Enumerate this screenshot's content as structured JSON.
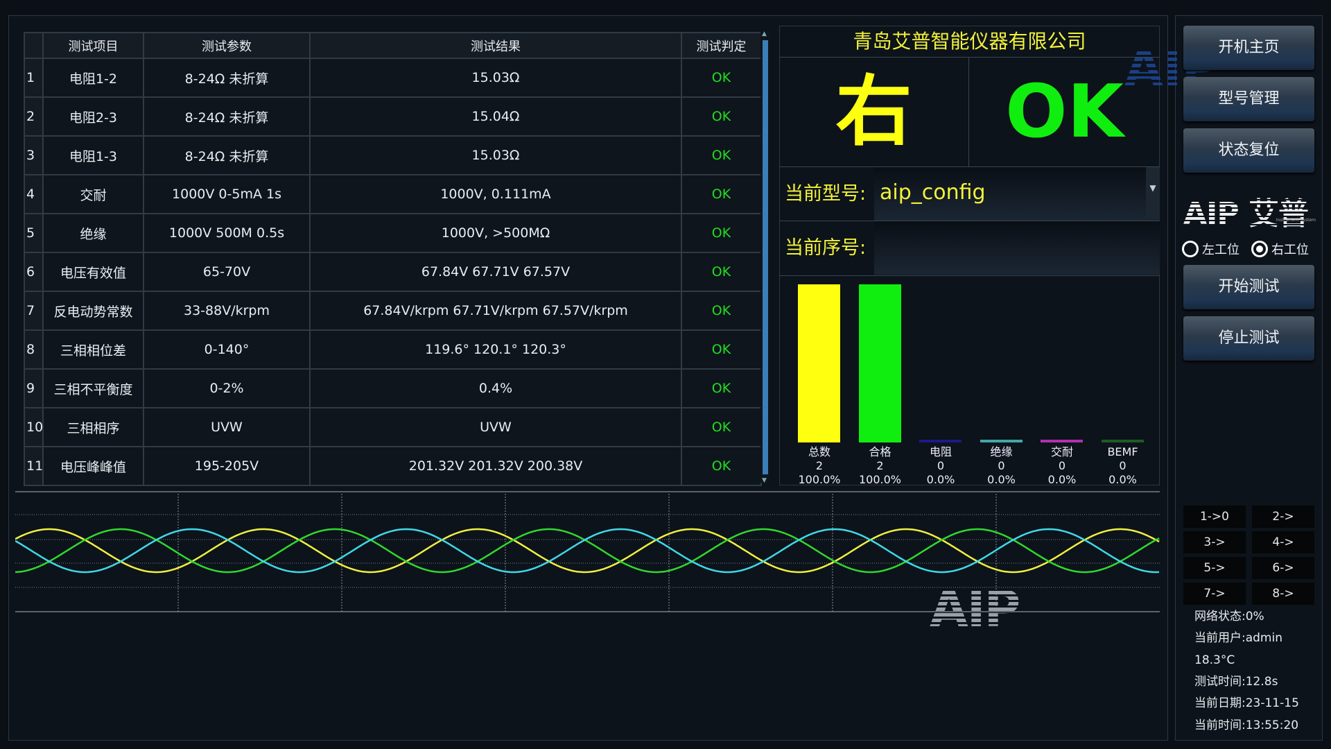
{
  "table": {
    "headers": [
      "",
      "测试项目",
      "测试参数",
      "测试结果",
      "测试判定"
    ],
    "rows": [
      [
        "1",
        "电阻1-2",
        "8-24Ω 未折算",
        "15.03Ω",
        "OK"
      ],
      [
        "2",
        "电阻2-3",
        "8-24Ω 未折算",
        "15.04Ω",
        "OK"
      ],
      [
        "3",
        "电阻1-3",
        "8-24Ω 未折算",
        "15.03Ω",
        "OK"
      ],
      [
        "4",
        "交耐",
        "1000V 0-5mA 1s",
        "1000V, 0.111mA",
        "OK"
      ],
      [
        "5",
        "绝缘",
        "1000V 500M 0.5s",
        "1000V, >500MΩ",
        "OK"
      ],
      [
        "6",
        "电压有效值",
        "65-70V",
        "67.84V  67.71V  67.57V",
        "OK"
      ],
      [
        "7",
        "反电动势常数",
        "33-88V/krpm",
        "67.84V/krpm  67.71V/krpm  67.57V/krpm",
        "OK"
      ],
      [
        "8",
        "三相相位差",
        "0-140°",
        "119.6°  120.1°  120.3°",
        "OK"
      ],
      [
        "9",
        "三相不平衡度",
        "0-2%",
        "0.4%",
        "OK"
      ],
      [
        "10",
        "三相相序",
        "UVW",
        "UVW",
        "OK"
      ],
      [
        "11",
        "电压峰峰值",
        "195-205V",
        "201.32V  201.32V  200.38V",
        "OK"
      ]
    ]
  },
  "info": {
    "company": "青岛艾普智能仪器有限公司",
    "side": "右",
    "result": "OK",
    "model_label": "当前型号:",
    "model_value": "aip_config",
    "serial_label": "当前序号:",
    "serial_value": ""
  },
  "chart_data": {
    "type": "bar",
    "categories": [
      "总数",
      "合格",
      "电阻",
      "绝缘",
      "交耐",
      "BEMF"
    ],
    "values": [
      2,
      2,
      0,
      0,
      0,
      0
    ],
    "percents": [
      "100.0%",
      "100.0%",
      "0.0%",
      "0.0%",
      "0.0%",
      "0.0%"
    ],
    "colors": [
      "#ffff10",
      "#10ee10",
      "#1a1a8a",
      "#40a8a8",
      "#b030b0",
      "#1f5a26"
    ],
    "ylim": [
      0,
      2
    ]
  },
  "waveform": {
    "series_colors": [
      "#f0f040",
      "#30d830",
      "#40d8e8"
    ],
    "phase_offset_deg": 120,
    "watermark": "AIP"
  },
  "sidebar": {
    "buttons": [
      "开机主页",
      "型号管理",
      "状态复位"
    ],
    "logo": "AIP 艾普",
    "logo_sub": "Instrument System",
    "watermark": "AIP",
    "stations": [
      {
        "label": "左工位",
        "selected": false
      },
      {
        "label": "右工位",
        "selected": true
      }
    ],
    "action_buttons": [
      "开始测试",
      "停止测试"
    ],
    "channels": [
      "1->0",
      "2->",
      "3->",
      "4->",
      "5->",
      "6->",
      "7->",
      "8->"
    ],
    "status": [
      "网络状态:0%",
      "当前用户:admin",
      "18.3°C",
      "测试时间:12.8s",
      "当前日期:23-11-15",
      "当前时间:13:55:20"
    ]
  },
  "colors": {
    "ok": "#1fe01f",
    "accent_yellow": "#f2f23a",
    "background": "#0b1016"
  }
}
